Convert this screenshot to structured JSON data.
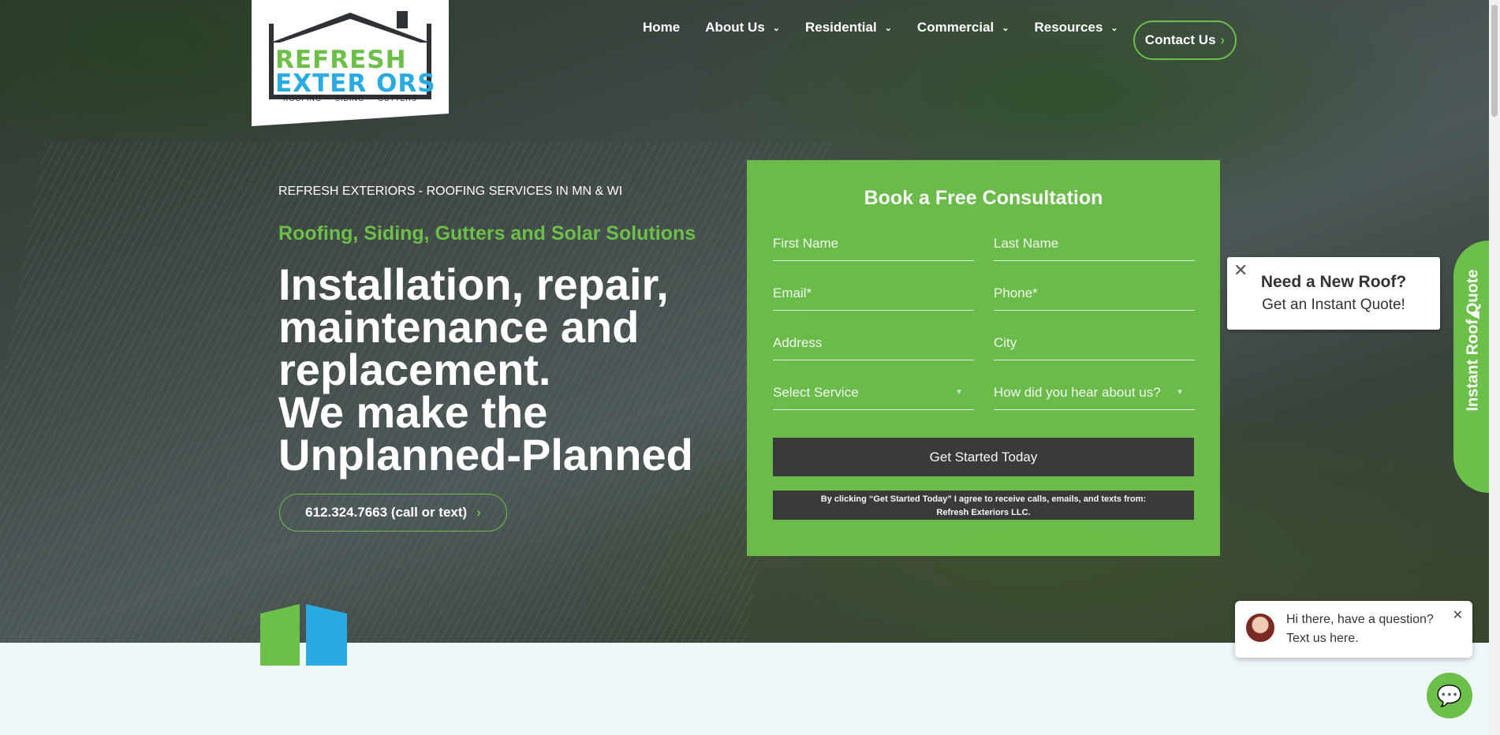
{
  "logo": {
    "brand_line1": "REFRESH",
    "brand_line2": "EXTER ORS",
    "tagline": "ROOFING — SIDING — GUTTERS"
  },
  "nav": {
    "items": [
      {
        "label": "Home",
        "has_dropdown": false
      },
      {
        "label": "About Us",
        "has_dropdown": true
      },
      {
        "label": "Residential",
        "has_dropdown": true
      },
      {
        "label": "Commercial",
        "has_dropdown": true
      },
      {
        "label": "Resources",
        "has_dropdown": true
      }
    ],
    "contact_label": "Contact Us"
  },
  "hero": {
    "eyebrow": "REFRESH EXTERIORS - ROOFING SERVICES IN MN & WI",
    "subhead": "Roofing, Siding, Gutters and Solar Solutions",
    "headline": {
      "line1": "Installation, repair,",
      "line2": "maintenance and",
      "line3": "replacement.",
      "line4": "We make the",
      "line5": "Unplanned-Planned"
    },
    "phone_label": "612.324.7663 (call or text)"
  },
  "form": {
    "title": "Book a Free Consultation",
    "fields": {
      "first_name": "First Name",
      "last_name": "Last Name",
      "email": "Email*",
      "phone": "Phone*",
      "address": "Address",
      "city": "City",
      "service": "Select Service",
      "referral": "How did you hear about us?"
    },
    "submit_label": "Get Started Today",
    "disclaimer_line1": "By clicking “Get Started Today” I agree to receive calls, emails, and texts from:",
    "disclaimer_line2": "Refresh Exteriors LLC."
  },
  "popup": {
    "title": "Need a New Roof?",
    "subtitle": "Get an Instant Quote!",
    "side_tab_label": "Instant Roof Quote"
  },
  "chat": {
    "message_line1": "Hi there, have a question?",
    "message_line2": "Text us here."
  },
  "colors": {
    "accent_green": "#6cc04a",
    "accent_blue": "#29abe2",
    "dark": "#3a3a3a"
  }
}
